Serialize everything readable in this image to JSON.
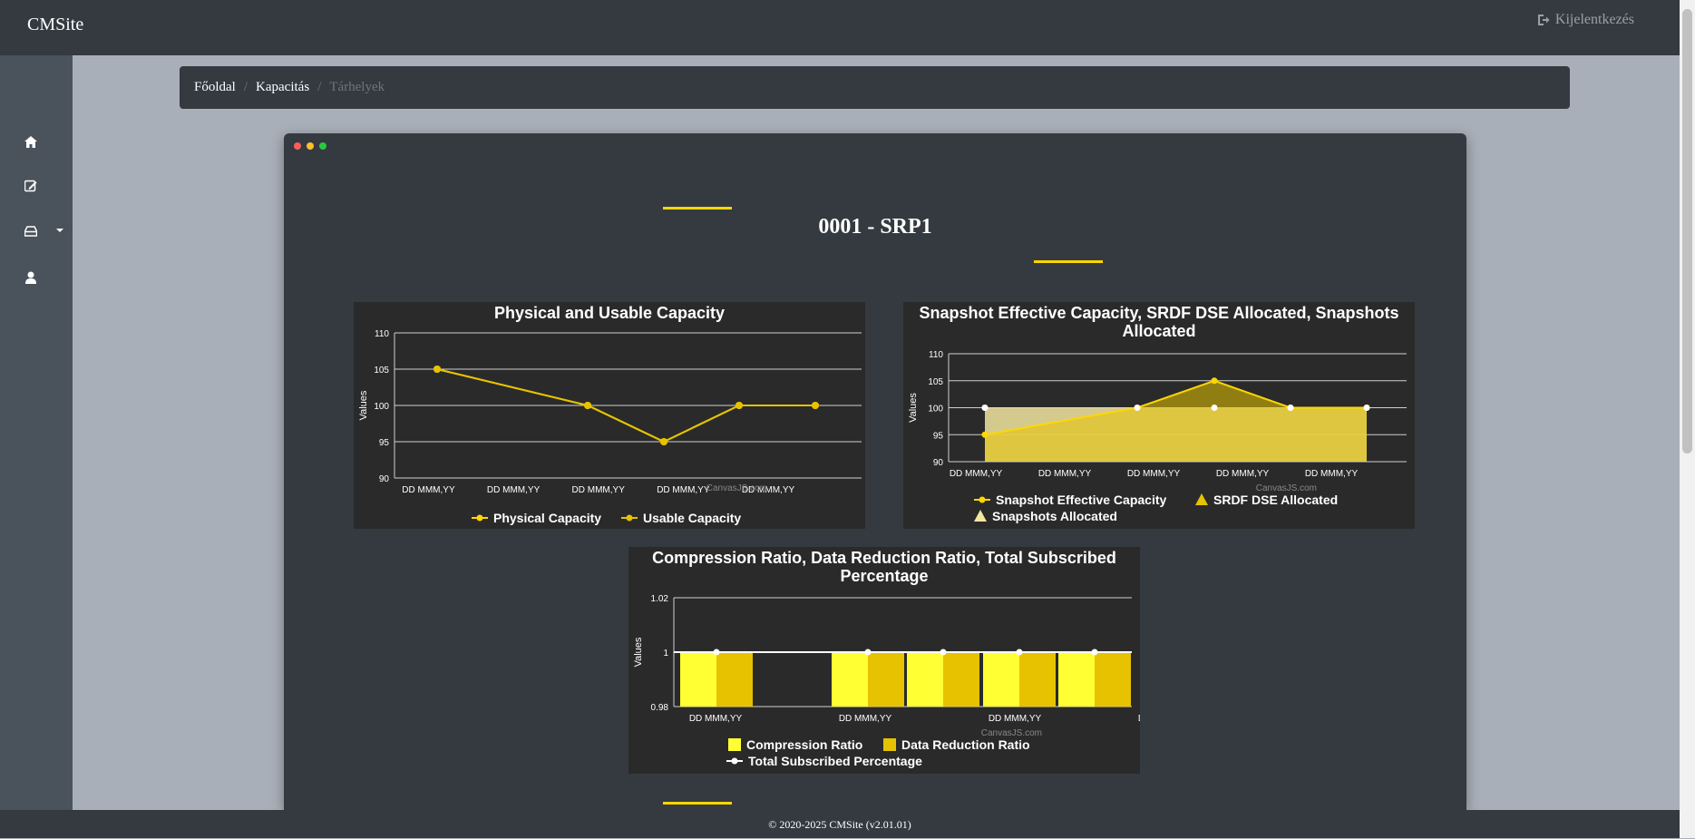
{
  "header": {
    "brand": "CMSite",
    "logout_label": "Kijelentkezés",
    "logout_icon": "sign-out-icon"
  },
  "sidebar": {
    "items": [
      {
        "icon": "home-icon"
      },
      {
        "icon": "edit-icon"
      },
      {
        "icon": "storage-icon"
      },
      {
        "icon": "user-icon"
      }
    ]
  },
  "breadcrumb": {
    "items": [
      "Főoldal",
      "Kapacitás",
      "Tárhelyek"
    ]
  },
  "page": {
    "title": "0001 - SRP1"
  },
  "colors": {
    "accent": "#ffd700",
    "panel": "#343a40",
    "chart_bg": "#2a2a2a"
  },
  "chart_data": [
    {
      "type": "line",
      "title": "Physical and Usable Capacity",
      "xlabel": "",
      "ylabel": "Values",
      "ylim": [
        90,
        110
      ],
      "yticks": [
        "90",
        "95",
        "100",
        "105",
        "110"
      ],
      "xticks": [
        "DD MMM,YY",
        "DD MMM,YY",
        "DD MMM,YY",
        "DD MMM,YY",
        "DD MMM,YY"
      ],
      "series": [
        {
          "name": "Physical Capacity",
          "color": "#ffd700",
          "values": [
            105,
            100,
            95,
            100,
            100
          ]
        },
        {
          "name": "Usable Capacity",
          "color": "#e6c200",
          "values": [
            105,
            100,
            95,
            100,
            100
          ]
        }
      ],
      "credit": "CanvasJS.com"
    },
    {
      "type": "area",
      "title": "Snapshot Effective Capacity, SRDF DSE Allocated, Snapshots Allocated",
      "title_lines": [
        "Snapshot Effective Capacity, SRDF DSE Allocated, Snapshots",
        "Allocated"
      ],
      "xlabel": "",
      "ylabel": "Values",
      "ylim": [
        90,
        110
      ],
      "yticks": [
        "90",
        "95",
        "100",
        "105",
        "110"
      ],
      "xticks": [
        "DD MMM,YY",
        "DD MMM,YY",
        "DD MMM,YY",
        "DD MMM,YY",
        "DD MMM,YY"
      ],
      "series": [
        {
          "name": "Snapshot Effective Capacity",
          "color": "#ffd700",
          "values": [
            95,
            100,
            105,
            100,
            100
          ]
        },
        {
          "name": "SRDF DSE Allocated",
          "color": "#e6c200",
          "values": [
            95,
            100,
            105,
            100,
            100
          ]
        },
        {
          "name": "Snapshots Allocated",
          "color": "#f3e6a0",
          "values": [
            100,
            100,
            100,
            100,
            100
          ]
        }
      ],
      "credit": "CanvasJS.com"
    },
    {
      "type": "bar",
      "title": "Compression Ratio, Data Reduction Ratio, Total Subscribed Percentage",
      "title_lines": [
        "Compression Ratio, Data Reduction Ratio, Total Subscribed",
        "Percentage"
      ],
      "xlabel": "",
      "ylabel": "Values",
      "ylim": [
        0.98,
        1.02
      ],
      "yticks": [
        "0.98",
        "1",
        "1.02"
      ],
      "xticks": [
        "DD MMM,YY",
        "DD MMM,YY",
        "DD MMM,YY",
        "DD MMM,YY"
      ],
      "series": [
        {
          "name": "Compression Ratio",
          "color": "#ffff33",
          "values": [
            1,
            null,
            1,
            1,
            1,
            1
          ]
        },
        {
          "name": "Data Reduction Ratio",
          "color": "#e6c200",
          "values": [
            1,
            null,
            1,
            1,
            1,
            1
          ]
        },
        {
          "name": "Total Subscribed Percentage",
          "color": "#ffffff",
          "values": [
            1,
            null,
            1,
            1,
            1,
            1
          ]
        }
      ],
      "credit": "CanvasJS.com"
    }
  ],
  "footer": {
    "text": "© 2020-2025 CMSite (v2.01.01)"
  }
}
